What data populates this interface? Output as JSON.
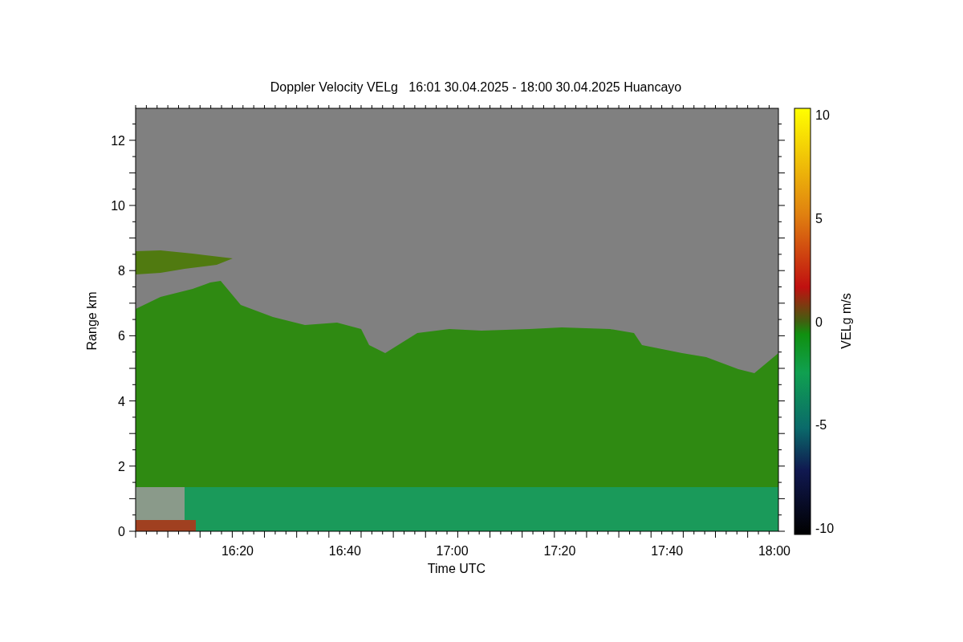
{
  "title": "Doppler Velocity VELg   16:01 30.04.2025 - 18:00 30.04.2025 Huancayo",
  "x_axis": {
    "label": "Time UTC",
    "ticks": [
      "16:20",
      "16:40",
      "17:00",
      "17:20",
      "17:40",
      "18:00"
    ]
  },
  "y_axis": {
    "label": "Range km",
    "ticks": [
      "12",
      "10",
      "8",
      "6",
      "4",
      "2",
      "0"
    ]
  },
  "colorbar": {
    "label": "VELg m/s",
    "ticks": [
      "10",
      "5",
      "0",
      "-5",
      "-10"
    ]
  }
}
